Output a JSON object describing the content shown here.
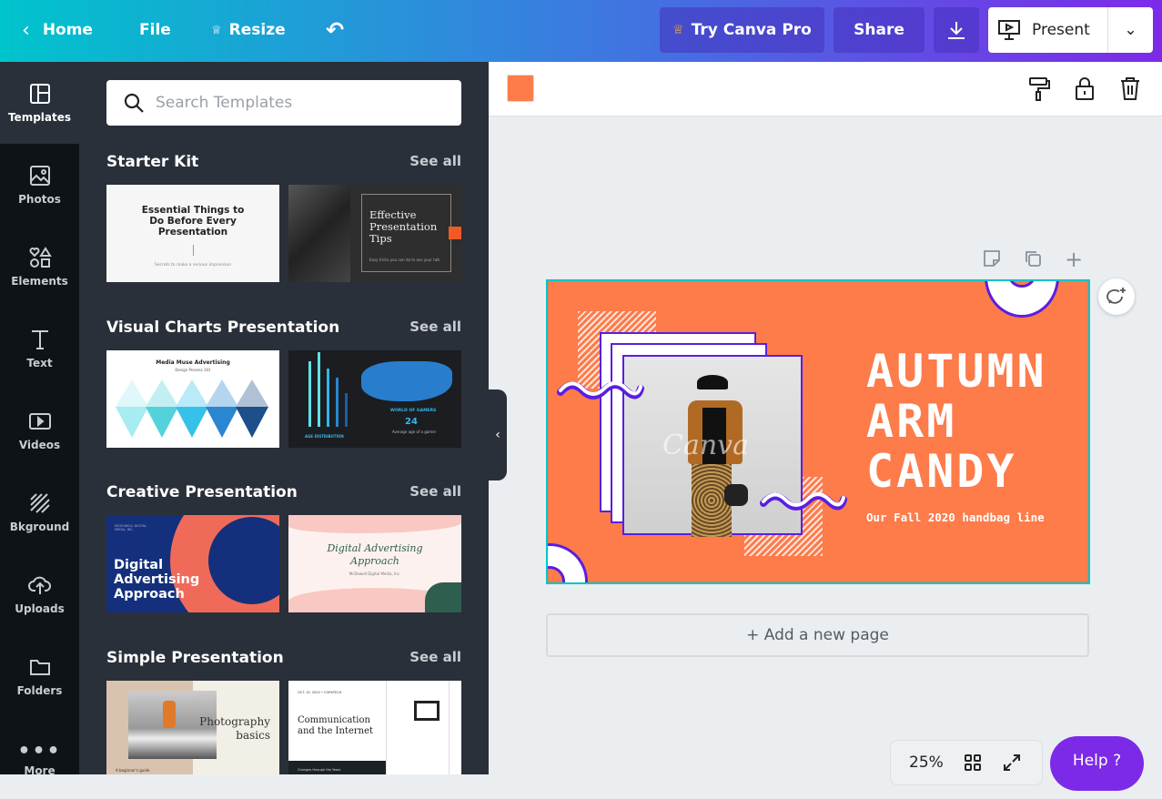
{
  "header": {
    "home": "Home",
    "file": "File",
    "resize": "Resize",
    "try_pro": "Try Canva Pro",
    "share": "Share",
    "present": "Present"
  },
  "rail": [
    {
      "label": "Templates",
      "icon": "templates-icon"
    },
    {
      "label": "Photos",
      "icon": "photos-icon"
    },
    {
      "label": "Elements",
      "icon": "elements-icon"
    },
    {
      "label": "Text",
      "icon": "text-icon"
    },
    {
      "label": "Videos",
      "icon": "videos-icon"
    },
    {
      "label": "Bkground",
      "icon": "background-icon"
    },
    {
      "label": "Uploads",
      "icon": "uploads-icon"
    },
    {
      "label": "Folders",
      "icon": "folders-icon"
    },
    {
      "label": "More",
      "icon": "more-icon"
    }
  ],
  "panel": {
    "search_placeholder": "Search Templates",
    "see_all": "See all",
    "sections": [
      {
        "title": "Starter Kit",
        "t1": "Essential Things to Do Before Every Presentation",
        "t1s": "Secrets to make a serious impression",
        "t2": "Effective Presentation Tips",
        "t2s": "Easy tricks you can do to ace your talk"
      },
      {
        "title": "Visual Charts Presentation",
        "t1": "Media Muse Advertising",
        "t1s": "Design Process 101",
        "t2": "WORLD OF GAMERS",
        "t2s": "24",
        "t2c": "Average age of a gamer",
        "t2d": "AGE DISTRIBUTION"
      },
      {
        "title": "Creative Presentation",
        "t1": "Digital Advertising Approach",
        "t1s": "MCDOWELL DIGITAL MEDIA, INC.",
        "t2": "Digital Advertising Approach",
        "t2s": "McDowell Digital Media, Inc."
      },
      {
        "title": "Simple Presentation",
        "t1": "Photography basics",
        "t1s": "A beginner's guide",
        "t2": "Communication and the Internet",
        "t2s": "OCT. 15, 2020 • CORSTECH",
        "t2c": "Changes through the Years"
      }
    ]
  },
  "toolbar": {
    "color": "#fe7b4a"
  },
  "slide": {
    "title_lines": [
      "AUTUMN",
      "ARM",
      "CANDY"
    ],
    "subtitle": "Our Fall 2020 handbag line",
    "watermark": "Canva"
  },
  "canvas": {
    "add_page": "+ Add a new page",
    "zoom": "25%",
    "help": "Help ?"
  },
  "colors": {
    "accent": "#7d2ae8",
    "slide_bg": "#fe7b4a",
    "selection": "#00c4cc"
  }
}
